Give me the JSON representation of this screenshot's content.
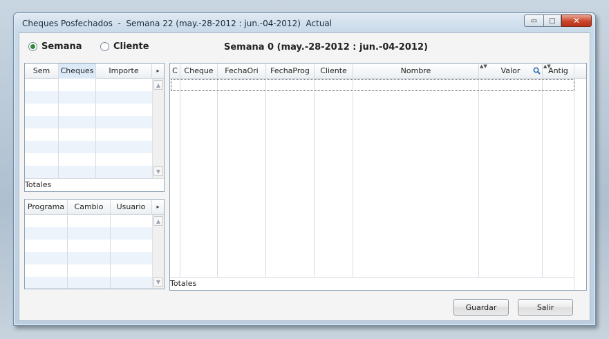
{
  "window": {
    "title": "Cheques Posfechados  -  Semana 22 (may.-28-2012 : jun.-04-2012)  Actual",
    "minimize_glyph": "▭",
    "maximize_glyph": "□",
    "close_glyph": "✕"
  },
  "filters": {
    "semana_label": "Semana",
    "cliente_label": "Cliente",
    "selected": "Semana"
  },
  "header": {
    "week_title": "Semana 0 (may.-28-2012 : jun.-04-2012)"
  },
  "weeks_grid": {
    "columns": [
      "Sem",
      "Cheques",
      "Importe"
    ],
    "more_arrow": "▸",
    "totals_label": "Totales"
  },
  "program_grid": {
    "columns": [
      "Programa",
      "Cambio",
      "Usuario"
    ],
    "more_arrow": "▸"
  },
  "cheques_grid": {
    "columns": [
      "C",
      "Cheque",
      "FechaOri",
      "FechaProg",
      "Cliente",
      "Nombre",
      "Valor",
      "Antig"
    ],
    "totals_label": "Totales"
  },
  "buttons": {
    "guardar": "Guardar",
    "salir": "Salir"
  },
  "colors": {
    "accent_radio": "#2f8a3a",
    "row_alt": "#ecf3fb",
    "close_button": "#c9452a"
  },
  "icons": {
    "scroll_up": "▲",
    "scroll_down": "▼",
    "sort": "▲▼"
  }
}
